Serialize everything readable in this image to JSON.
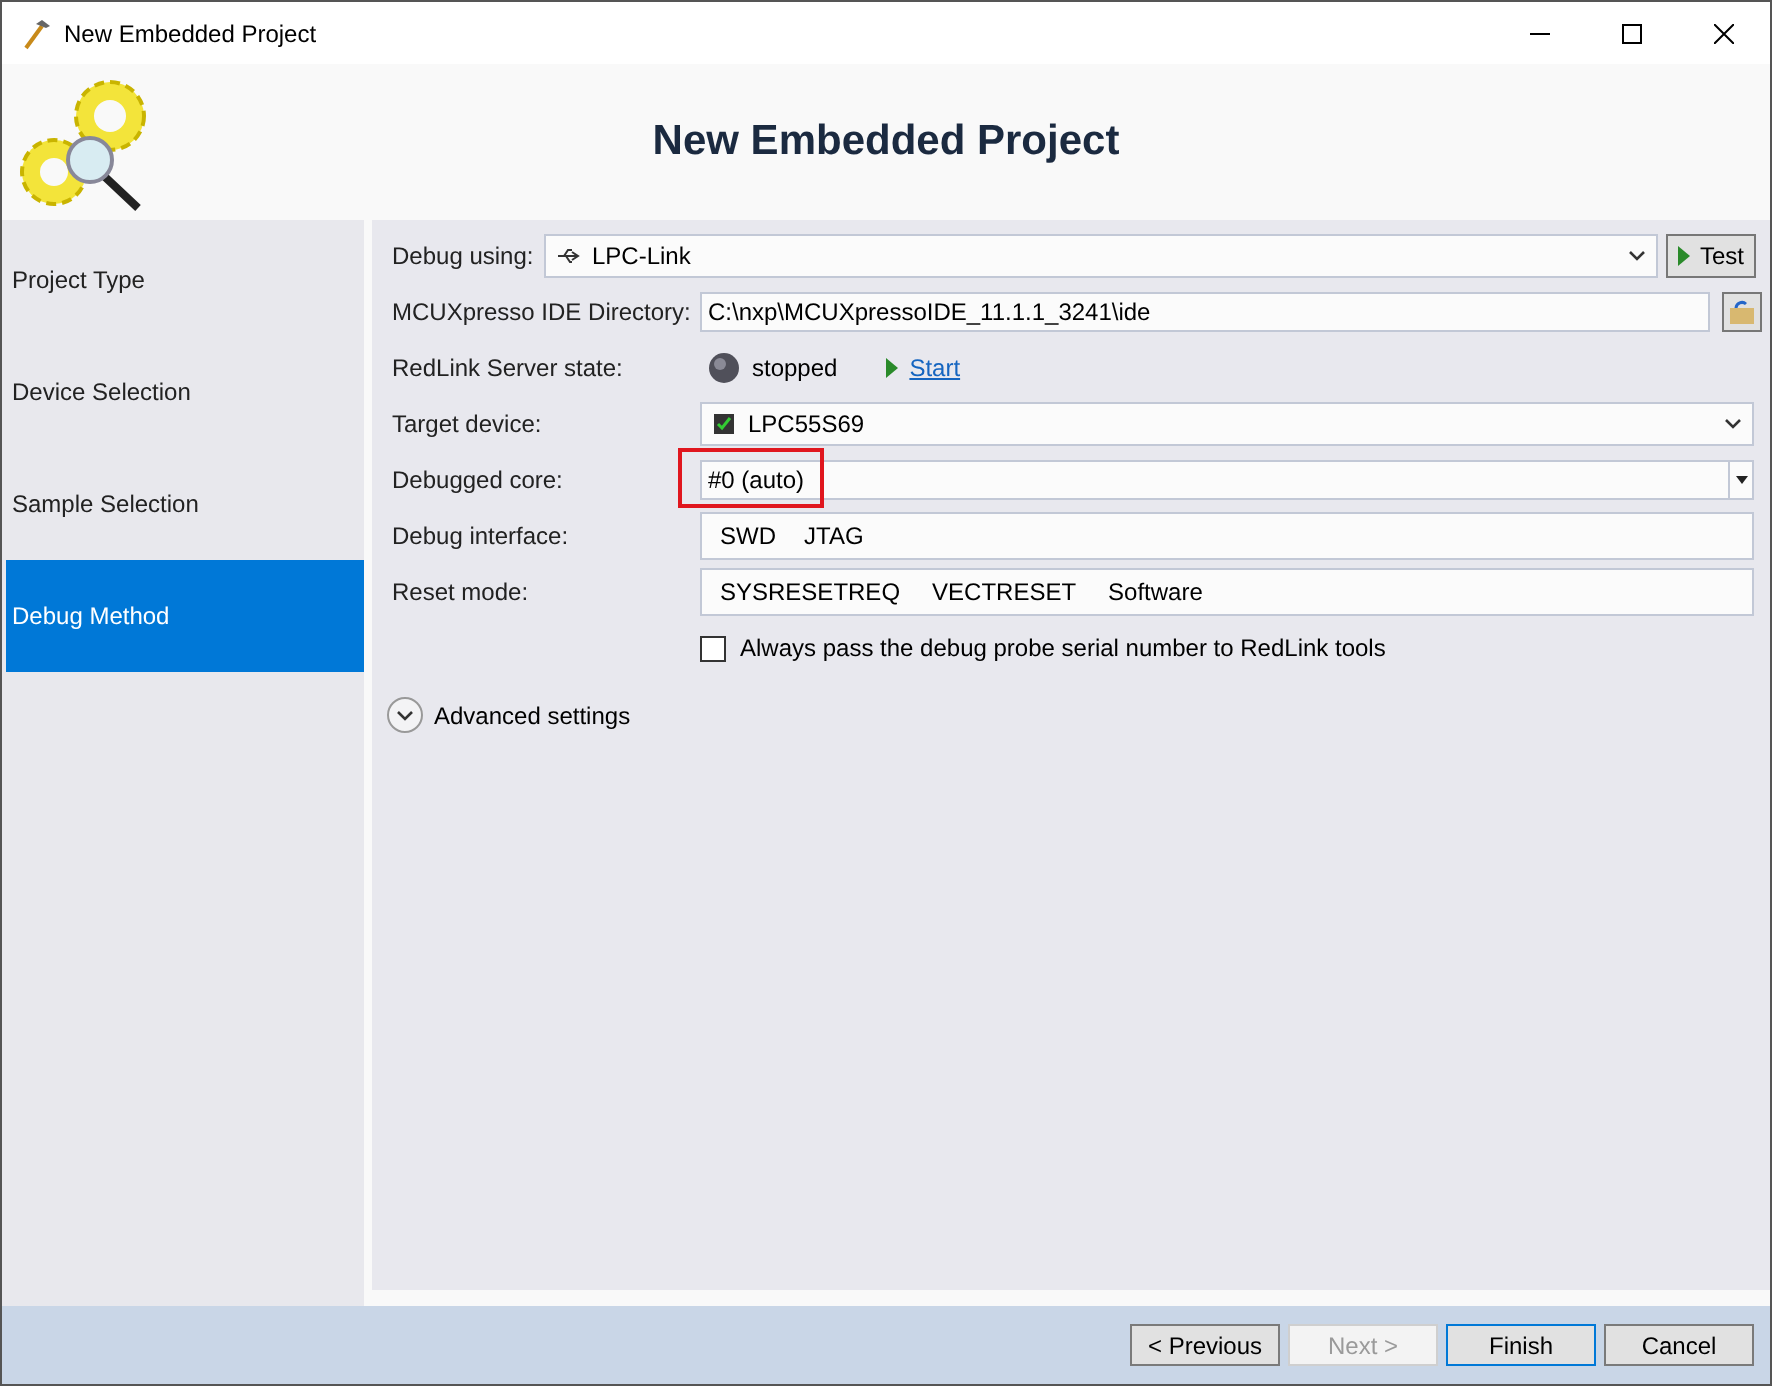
{
  "window": {
    "title": "New Embedded Project"
  },
  "header": {
    "title": "New Embedded Project"
  },
  "sidebar": {
    "items": [
      {
        "label": "Project Type",
        "selected": false
      },
      {
        "label": "Device Selection",
        "selected": false
      },
      {
        "label": "Sample Selection",
        "selected": false
      },
      {
        "label": "Debug Method",
        "selected": true
      }
    ]
  },
  "form": {
    "debug_using": {
      "label": "Debug using:",
      "value": "LPC-Link",
      "button": "Test"
    },
    "ide_directory": {
      "label": "MCUXpresso IDE Directory:",
      "value": "C:\\nxp\\MCUXpressoIDE_11.1.1_3241\\ide"
    },
    "redlink_state": {
      "label": "RedLink Server state:",
      "status": "stopped",
      "link": "Start"
    },
    "target_device": {
      "label": "Target device:",
      "value": "LPC55S69"
    },
    "debugged_core": {
      "label": "Debugged core:",
      "value": "#0 (auto)",
      "highlighted": true
    },
    "debug_interface": {
      "label": "Debug interface:",
      "options": [
        "SWD",
        "JTAG"
      ]
    },
    "reset_mode": {
      "label": "Reset mode:",
      "options": [
        "SYSRESETREQ",
        "VECTRESET",
        "Software"
      ]
    },
    "serial_checkbox": {
      "label": "Always pass the debug probe serial number to RedLink tools",
      "checked": false
    },
    "advanced": {
      "label": "Advanced settings",
      "expanded": false
    }
  },
  "buttons": [
    {
      "label": "< Previous",
      "disabled": false,
      "default": false
    },
    {
      "label": "Next >",
      "disabled": true,
      "default": false
    },
    {
      "label": "Finish",
      "disabled": false,
      "default": true
    },
    {
      "label": "Cancel",
      "disabled": false,
      "default": false
    }
  ]
}
